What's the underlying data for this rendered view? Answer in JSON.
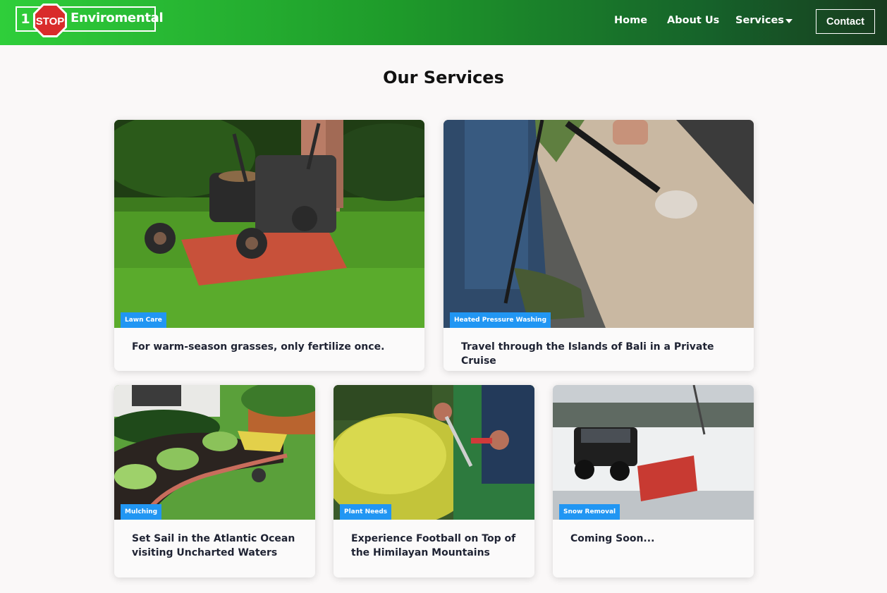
{
  "header": {
    "logo": {
      "number": "1",
      "stop": "STOP",
      "name": "Enviromental"
    },
    "nav": {
      "home": "Home",
      "about": "About Us",
      "services": "Services"
    },
    "contact": "Contact"
  },
  "main": {
    "title": "Our Services",
    "cards": [
      {
        "tag": "Lawn Care",
        "text": "For warm-season grasses, only fertilize once."
      },
      {
        "tag": "Heated Pressure Washing",
        "text": "Travel through the Islands of Bali in a Private Cruise"
      },
      {
        "tag": "Mulching",
        "text": "Set Sail in the Atlantic Ocean visiting Uncharted Waters"
      },
      {
        "tag": "Plant Needs",
        "text": "Experience Football on Top of the Himilayan Mountains"
      },
      {
        "tag": "Snow Removal",
        "text": "Coming Soon..."
      }
    ]
  },
  "colors": {
    "tag": "#2196f3",
    "header_start": "#2fce3a",
    "header_end": "#183c1f"
  }
}
